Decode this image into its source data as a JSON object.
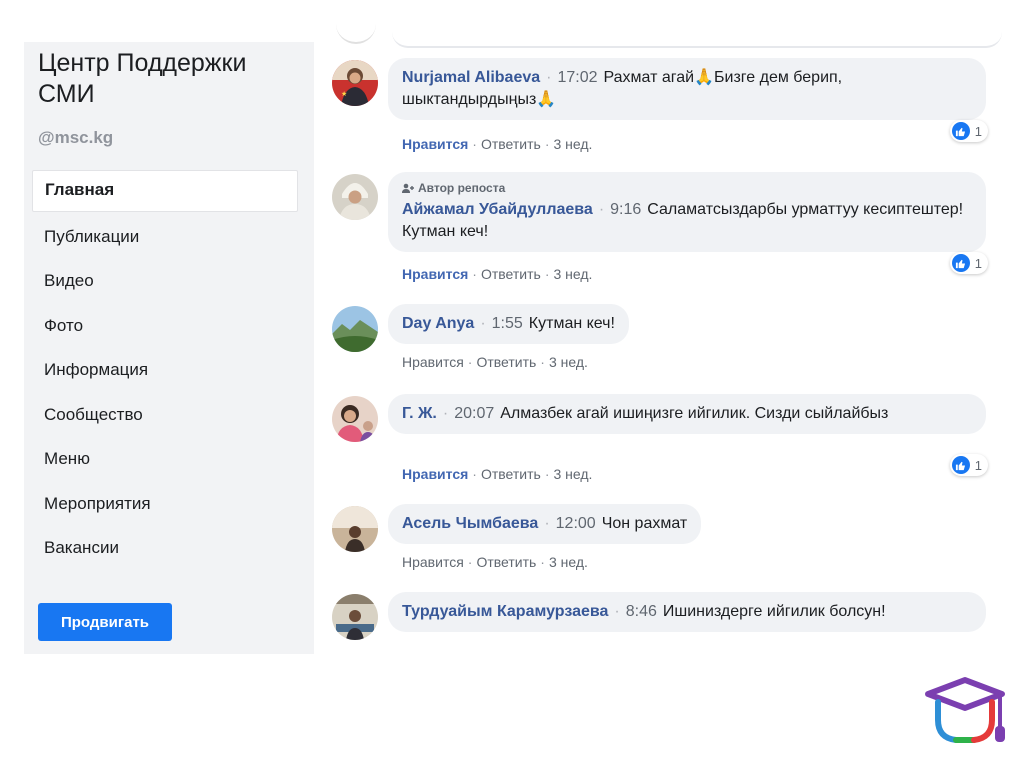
{
  "sidebar": {
    "page_title": "Центр Поддержки СМИ",
    "handle": "@msc.kg",
    "nav_items": [
      {
        "label": "Главная",
        "active": true
      },
      {
        "label": "Публикации"
      },
      {
        "label": "Видео"
      },
      {
        "label": "Фото"
      },
      {
        "label": "Информация"
      },
      {
        "label": "Сообщество"
      },
      {
        "label": "Меню"
      },
      {
        "label": "Мероприятия"
      },
      {
        "label": "Вакансии"
      }
    ],
    "promote_label": "Продвигать"
  },
  "comments": [
    {
      "author": "Nurjamal Alibaeva",
      "time": "17:02",
      "text": "Рахмат агай🙏Бизге дем берип, шыктандырдыңыз🙏",
      "like_label": "Нравится",
      "reply_label": "Ответить",
      "age": "3 нед.",
      "reaction_count": "1",
      "avatar_icon": "user-avatar-photo"
    },
    {
      "repost_label": "Автор репоста",
      "author": "Айжамал Убайдуллаева",
      "time": "9:16",
      "text": "Саламатсыздарбы урматтуу кесиптештер! Кутман кеч!",
      "like_label": "Нравится",
      "reply_label": "Ответить",
      "age": "3 нед.",
      "reaction_count": "1",
      "avatar_icon": "user-avatar-photo"
    },
    {
      "author": "Day Anya",
      "time": "1:55",
      "text": "Кутман кеч!",
      "like_label": "Нравится",
      "reply_label": "Ответить",
      "age": "3 нед.",
      "avatar_icon": "landscape-avatar-photo"
    },
    {
      "author": "Г. Ж.",
      "time": "20:07",
      "text": "Алмазбек агай ишиңизге ийгилик. Сизди сыйлайбыз",
      "like_label": "Нравится",
      "reply_label": "Ответить",
      "age": "3 нед.",
      "reaction_count": "1",
      "avatar_icon": "user-avatar-photo"
    },
    {
      "author": "Асель Чымбаева",
      "time": "12:00",
      "text": "Чон рахмат",
      "like_label": "Нравится",
      "reply_label": "Ответить",
      "age": "3 нед.",
      "avatar_icon": "user-avatar-photo"
    },
    {
      "author": "Турдуайым Карамурзаева",
      "time": "8:46",
      "text": "Ишиниздерге ийгилик болсун!",
      "avatar_icon": "user-avatar-photo"
    }
  ],
  "colors": {
    "link_blue": "#385898",
    "like_blue": "#4267b2",
    "button_blue": "#1877f2",
    "bubble_bg": "#f0f2f5",
    "sidebar_bg": "#f2f3f5"
  },
  "logo_icon": "graduation-cap-logo-icon"
}
